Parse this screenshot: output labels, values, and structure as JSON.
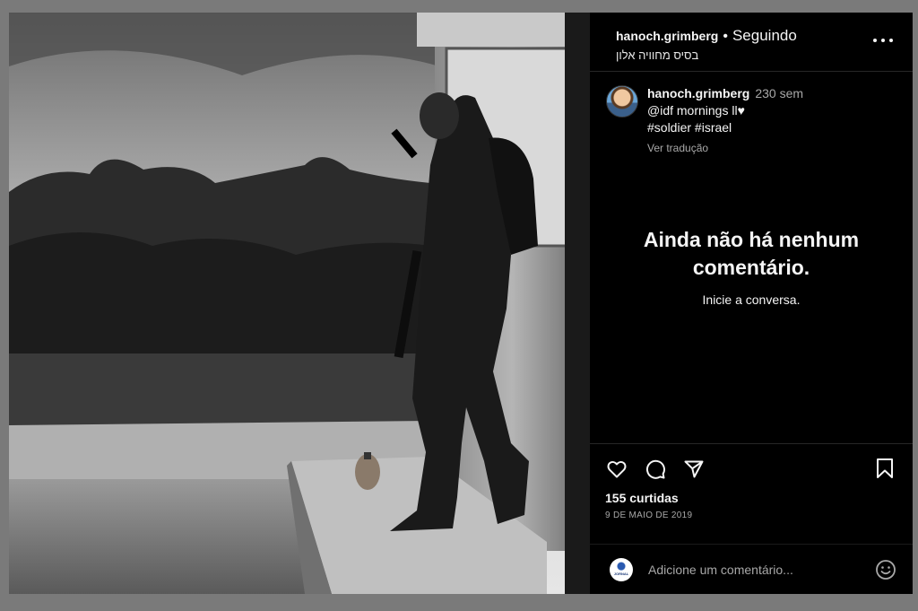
{
  "post": {
    "username": "hanoch.grimberg",
    "separator": "•",
    "follow_status": "Seguindo",
    "location": "בסיס מחוויה אלון"
  },
  "caption": {
    "username": "hanoch.grimberg",
    "time": "230 sem",
    "line1": "@idf mornings ll♥",
    "line2": "#soldier #israel",
    "translate": "Ver tradução"
  },
  "empty_comments": {
    "title": "Ainda não há nenhum comentário.",
    "subtitle": "Inicie a conversa."
  },
  "actions": {
    "like_icon": "heart-icon",
    "comment_icon": "comment-icon",
    "share_icon": "send-icon",
    "save_icon": "bookmark-icon"
  },
  "stats": {
    "likes": "155 curtidas",
    "date": "9 DE MAIO DE 2019"
  },
  "comment_box": {
    "placeholder": "Adicione um comentário...",
    "logo_text": "JORNAL"
  },
  "colors": {
    "background": "#000000",
    "text": "#f5f5f5",
    "muted": "#a8a8a8",
    "divider": "#262626"
  }
}
